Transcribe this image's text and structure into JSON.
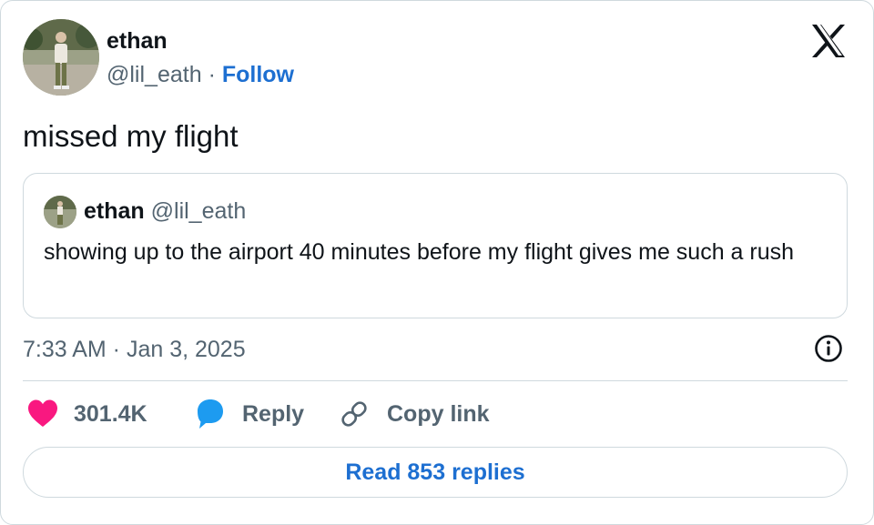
{
  "tweet": {
    "author_name": "ethan",
    "author_handle": "@lil_eath",
    "separator": "·",
    "follow_label": "Follow",
    "text": "missed my flight",
    "timestamp": "7:33 AM · Jan 3, 2025"
  },
  "quoted_tweet": {
    "author_name": "ethan",
    "author_handle": "@lil_eath",
    "text": "showing up to the airport 40 minutes before my flight gives me such a rush"
  },
  "actions": {
    "like_count": "301.4K",
    "reply_label": "Reply",
    "copy_link_label": "Copy link"
  },
  "read_replies_label": "Read 853 replies",
  "icons": {
    "logo": "x-logo-icon",
    "info": "info-icon",
    "like": "heart-icon",
    "reply": "speech-bubble-icon",
    "copy": "link-icon"
  },
  "colors": {
    "accent": "#1d6fd1",
    "like": "#f91880",
    "secondary_text": "#536471",
    "border": "#cfd9de"
  }
}
